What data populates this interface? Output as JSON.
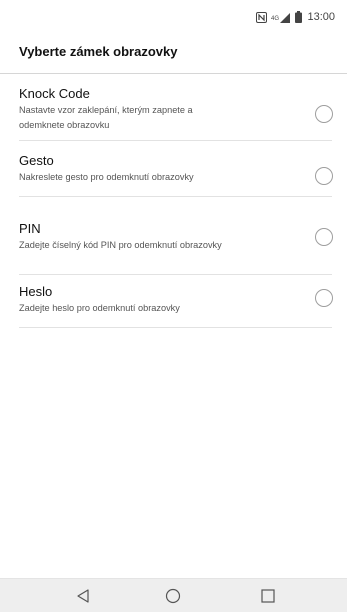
{
  "status_bar": {
    "time": "13:00",
    "icons": [
      "nfc-icon",
      "signal-icon",
      "battery-icon"
    ]
  },
  "header": {
    "title": "Vyberte zámek obrazovky"
  },
  "options": [
    {
      "title": "Knock Code",
      "subtitle_line1": "Nastavte vzor zaklepání, kterým zapnete a",
      "subtitle_line2": "odemknete obrazovku",
      "selected": false
    },
    {
      "title": "Gesto",
      "subtitle_line1": "Nakreslete gesto pro odemknutí obrazovky",
      "selected": false
    },
    {
      "title": "PIN",
      "subtitle_line1": "Zadejte číselný kód PIN pro odemknutí obrazovky",
      "selected": false
    },
    {
      "title": "Heslo",
      "subtitle_line1": "Zadejte heslo pro odemknutí obrazovky",
      "selected": false
    }
  ],
  "nav_bar": {
    "buttons": [
      "back-icon",
      "home-icon",
      "recents-icon"
    ]
  },
  "colors": {
    "background": "#ffffff",
    "nav_background": "#eeeeee",
    "divider": "#e2e2e2",
    "radio_border": "#9e9e9e"
  }
}
